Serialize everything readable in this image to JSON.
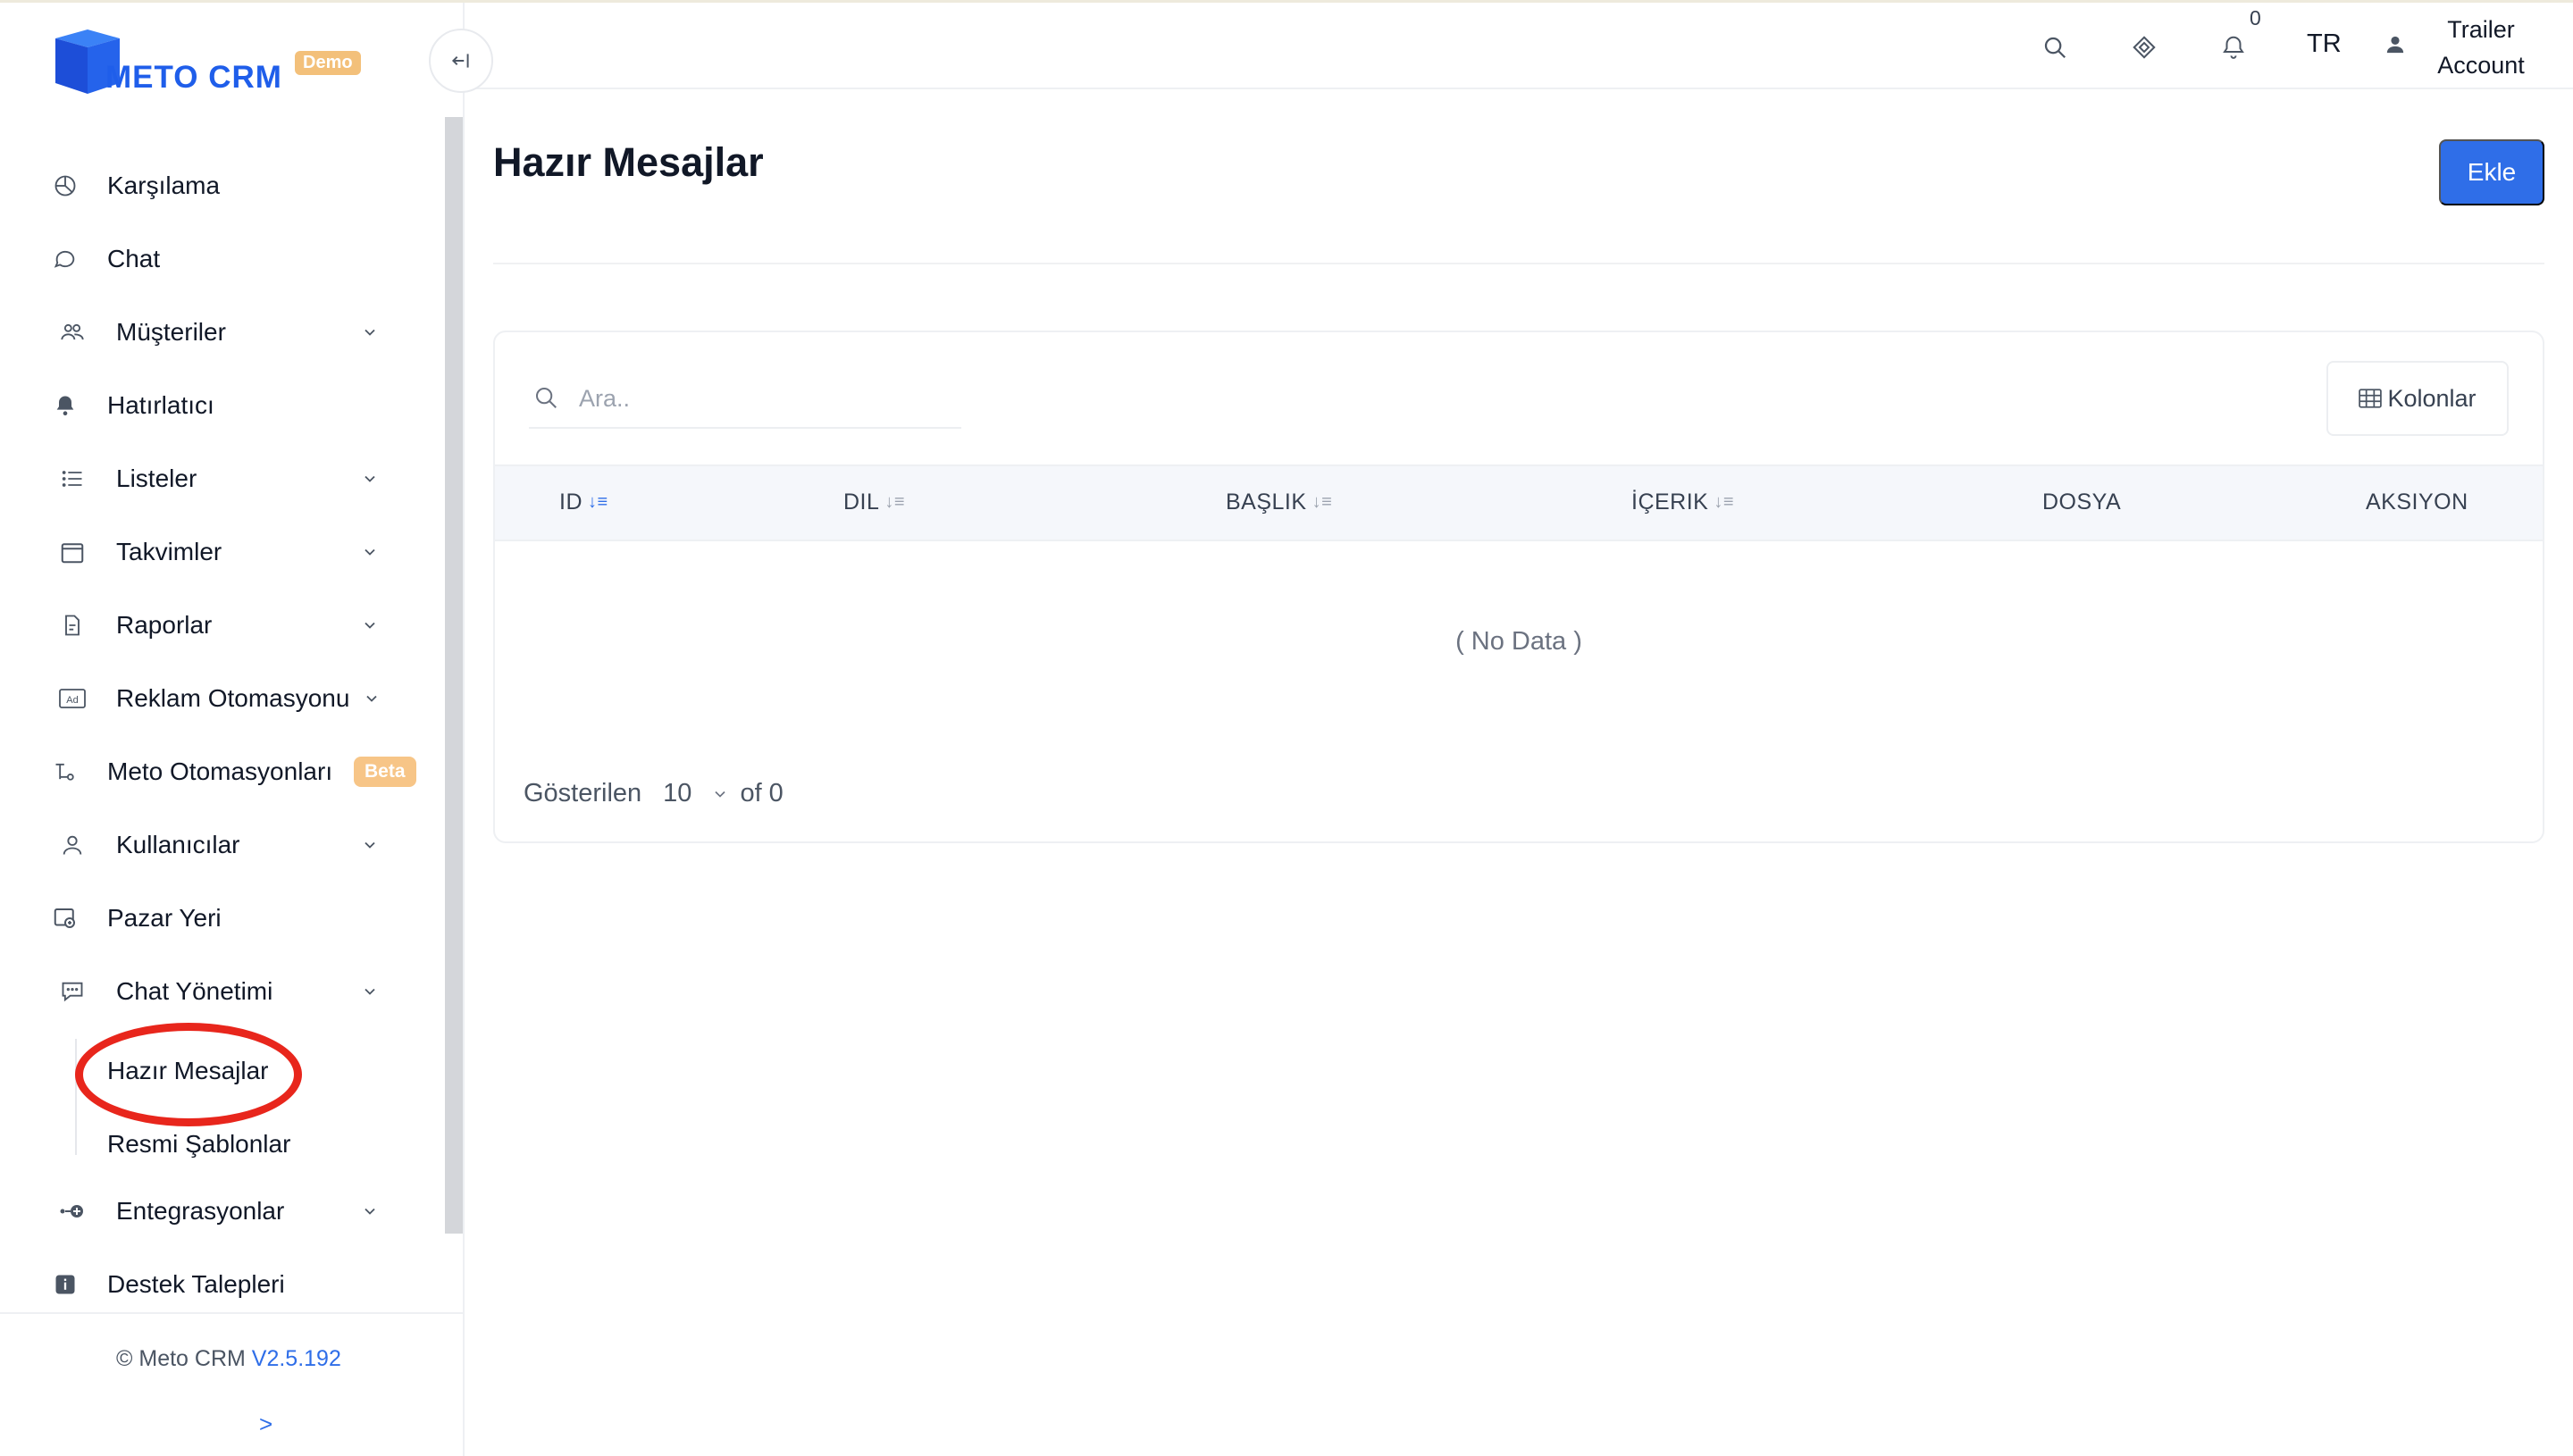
{
  "app": {
    "logo_text": "METO CRM",
    "logo_badge": "Demo",
    "brand_color": "#1f5eea",
    "accent_color": "#2f6ee8"
  },
  "sidebar": {
    "items": [
      {
        "label": "Karşılama",
        "icon": "pie-chart-icon",
        "chevron": false
      },
      {
        "label": "Chat",
        "icon": "chat-bubble-icon",
        "chevron": false
      },
      {
        "label": "Müşteriler",
        "icon": "users-icon",
        "chevron": true
      },
      {
        "label": "Hatırlatıcı",
        "icon": "bell-icon",
        "chevron": false
      },
      {
        "label": "Listeler",
        "icon": "list-icon",
        "chevron": true
      },
      {
        "label": "Takvimler",
        "icon": "calendar-icon",
        "chevron": true
      },
      {
        "label": "Raporlar",
        "icon": "report-icon",
        "chevron": true
      },
      {
        "label": "Reklam Otomasyonu",
        "icon": "ad-icon",
        "chevron": true
      },
      {
        "label": "Meto Otomasyonları",
        "icon": "automation-icon",
        "badge": "Beta"
      },
      {
        "label": "Kullanıcılar",
        "icon": "user-icon",
        "chevron": true
      },
      {
        "label": "Pazar Yeri",
        "icon": "marketplace-icon",
        "chevron": false
      },
      {
        "label": "Chat Yönetimi",
        "icon": "chat-manage-icon",
        "chevron": true
      },
      {
        "label": "Entegrasyonlar",
        "icon": "integration-icon",
        "chevron": true
      },
      {
        "label": "Destek Talepleri",
        "icon": "info-icon",
        "chevron": false
      }
    ],
    "sub_items": [
      "Hazır Mesajlar",
      "Resmi Şablonlar"
    ],
    "footer": {
      "copyright": "© Meto CRM",
      "version": "V2.5.192",
      "arrow": ">"
    }
  },
  "topbar": {
    "notification_count": "0",
    "language": "TR",
    "user_line1": "Trailer",
    "user_line2": "Account"
  },
  "main": {
    "title": "Hazır Mesajlar",
    "add_label": "Ekle",
    "search_placeholder": "Ara..",
    "columns_label": "Kolonlar",
    "columns": [
      "ID",
      "DIL",
      "BAŞLIK",
      "İÇERIK",
      "DOSYA",
      "AKSIYON"
    ],
    "empty_text": "( No Data )",
    "pager": {
      "label": "Gösterilen",
      "page_size": "10",
      "of_text": "of 0"
    }
  }
}
